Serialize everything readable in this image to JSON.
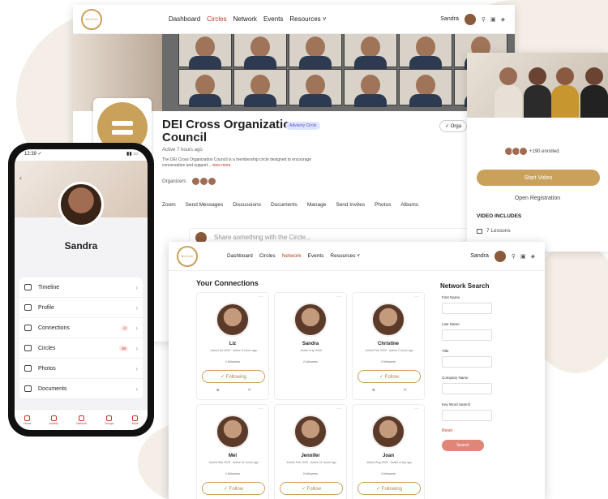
{
  "circles_window": {
    "nav": {
      "logo": "BeCircle",
      "links": [
        "Dashboard",
        "Circles",
        "Network",
        "Events",
        "Resources ˅"
      ],
      "active_link": "Circles",
      "user": "Sandra"
    },
    "title": "DEI Cross Organization Council",
    "tag": "Advisory Circle",
    "meta": "Active 7 hours ago",
    "description": "The DEI Cross Organization Council is a membership circle designed to encourage conversation and support...",
    "view_more": "view more",
    "organizers_label": "Organizers",
    "org_button": "✓ Orga",
    "tabs": [
      "Zoom",
      "Send Messages",
      "Discussions",
      "Documents",
      "Manage",
      "Send Invites",
      "Photos",
      "Albums"
    ],
    "share_placeholder": "Share something with the Circle..."
  },
  "course_card": {
    "enrolled": "+190 enrolled",
    "start_button": "Start Video",
    "open_registration": "Open Registration",
    "video_includes": "VIDEO INCLUDES",
    "lessons": "7 Lessons"
  },
  "phone": {
    "time": "12:39 ✓",
    "signal": "▮▮ ▭",
    "name": "Sandra",
    "menu": [
      {
        "label": "Timeline",
        "count": ""
      },
      {
        "label": "Profile",
        "count": ""
      },
      {
        "label": "Connections",
        "count": "4"
      },
      {
        "label": "Circles",
        "count": "38"
      },
      {
        "label": "Photos",
        "count": ""
      },
      {
        "label": "Documents",
        "count": ""
      }
    ],
    "tabbar": [
      "Home",
      "Activity",
      "Network",
      "Groups",
      "More"
    ]
  },
  "network_window": {
    "nav": {
      "logo": "BeCircle",
      "links": [
        "Dashboard",
        "Circles",
        "Network",
        "Events",
        "Resources ˅"
      ],
      "active_link": "Network",
      "user": "Sandra"
    },
    "heading": "Your Connections",
    "connections": [
      {
        "name": "Liz",
        "sub": "Joined Jul 2020 · Active 5 hours ago",
        "followers": "1 followers",
        "button": "✓ Following"
      },
      {
        "name": "Sandra",
        "sub": "Active 6 sp 2020",
        "followers": "2 followers",
        "button": ""
      },
      {
        "name": "Christine",
        "sub": "Joined Feb 2020 · Active 2 hours ago",
        "followers": "2 followers",
        "button": "✓ Follow"
      },
      {
        "name": "Mel",
        "sub": "Joined Mar 2020 · Active 11 hours ago",
        "followers": "1 followers",
        "button": "✓ Follow"
      },
      {
        "name": "Jennifer",
        "sub": "Joined Feb 2020 · Active 21 hours ago",
        "followers": "0 followers",
        "button": "✓ Follow"
      },
      {
        "name": "Joan",
        "sub": "Joined Aug 2020 · Active a day ago",
        "followers": "4 followers",
        "button": "✓ Following"
      }
    ],
    "search": {
      "title": "Network Search",
      "fields": [
        "First Name",
        "Last Name",
        "Title",
        "Company Name",
        "Key Word Search"
      ],
      "reset": "Reset",
      "button": "Search"
    }
  }
}
